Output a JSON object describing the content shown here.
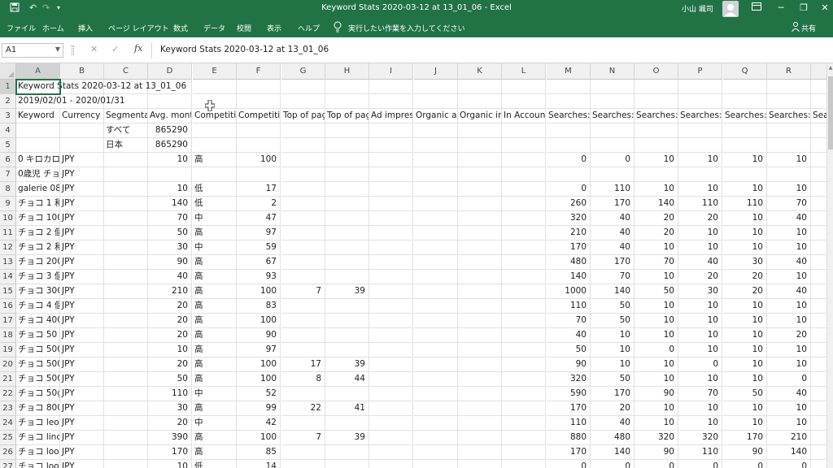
{
  "titlebar": {
    "title": "Keyword Stats 2020-03-12 at 13_01_06  -  Excel",
    "user": "小山 颯司",
    "icons": [
      "save-icon",
      "undo-icon",
      "redo-icon",
      "customize-qat-icon",
      "ribbon-display-icon",
      "minimize-icon",
      "restore-icon",
      "close-icon"
    ]
  },
  "ribbon": {
    "tabs": [
      "ファイル",
      "ホーム",
      "挿入",
      "ページ レイアウト",
      "数式",
      "データ",
      "校閲",
      "表示",
      "ヘルプ"
    ],
    "tell_me": "実行したい作業を入力してください",
    "share": "共有"
  },
  "formula_bar": {
    "name_box": "A1",
    "fx": "fx",
    "content": "Keyword Stats 2020-03-12 at 13_01_06"
  },
  "sheet": {
    "columns": [
      "A",
      "B",
      "C",
      "D",
      "E",
      "F",
      "G",
      "H",
      "I",
      "J",
      "K",
      "L",
      "M",
      "N",
      "O",
      "P",
      "Q",
      "R"
    ],
    "selected_cell": "A1",
    "rows": [
      {
        "n": "1",
        "cells": {
          "A": "Keyword Stats 2020-03-12 at 13_01_06"
        }
      },
      {
        "n": "2",
        "cells": {
          "A": "2019/02/01 - 2020/01/31"
        }
      },
      {
        "n": "3",
        "cells": {
          "A": "Keyword",
          "B": "Currency",
          "C": "Segmentat",
          "D": "Avg. mont",
          "E": "Competitic",
          "F": "Competitic",
          "G": "Top of pag",
          "H": "Top of pag",
          "I": "Ad impres",
          "J": "Organic av",
          "K": "Organic im",
          "L": "In Account",
          "M": "Searches:",
          "N": "Searches:",
          "O": "Searches:",
          "P": "Searches:",
          "Q": "Searches:",
          "R": "Searches:",
          "S": "Sea"
        }
      },
      {
        "n": "4",
        "cells": {
          "C": "すべて",
          "D": "865290"
        }
      },
      {
        "n": "5",
        "cells": {
          "C": "日本",
          "D": "865290"
        }
      },
      {
        "n": "6",
        "cells": {
          "A": "0 キロカロ",
          "B": "JPY",
          "D": "10",
          "E": "高",
          "F": "100",
          "M": "0",
          "N": "0",
          "O": "10",
          "P": "10",
          "Q": "10",
          "R": "10"
        }
      },
      {
        "n": "7",
        "cells": {
          "A": "0歳児 チョ",
          "B": "JPY"
        }
      },
      {
        "n": "8",
        "cells": {
          "A": "galerie 08",
          "B": "JPY",
          "D": "10",
          "E": "低",
          "F": "17",
          "M": "0",
          "N": "110",
          "O": "10",
          "P": "10",
          "Q": "10",
          "R": "10"
        }
      },
      {
        "n": "9",
        "cells": {
          "A": "チョコ 1 和",
          "B": "JPY",
          "D": "140",
          "E": "低",
          "F": "2",
          "M": "260",
          "N": "170",
          "O": "140",
          "P": "110",
          "Q": "110",
          "R": "70"
        }
      },
      {
        "n": "10",
        "cells": {
          "A": "チョコ 100",
          "B": "JPY",
          "D": "70",
          "E": "中",
          "F": "47",
          "M": "320",
          "N": "40",
          "O": "20",
          "P": "20",
          "Q": "10",
          "R": "40"
        }
      },
      {
        "n": "11",
        "cells": {
          "A": "チョコ 2 個",
          "B": "JPY",
          "D": "50",
          "E": "高",
          "F": "97",
          "M": "210",
          "N": "40",
          "O": "20",
          "P": "10",
          "Q": "10",
          "R": "10"
        }
      },
      {
        "n": "12",
        "cells": {
          "A": "チョコ 2 和",
          "B": "JPY",
          "D": "30",
          "E": "中",
          "F": "59",
          "M": "170",
          "N": "40",
          "O": "10",
          "P": "10",
          "Q": "10",
          "R": "10"
        }
      },
      {
        "n": "13",
        "cells": {
          "A": "チョコ 200",
          "B": "JPY",
          "D": "90",
          "E": "高",
          "F": "67",
          "M": "480",
          "N": "170",
          "O": "70",
          "P": "40",
          "Q": "30",
          "R": "40"
        }
      },
      {
        "n": "14",
        "cells": {
          "A": "チョコ 3 個",
          "B": "JPY",
          "D": "40",
          "E": "高",
          "F": "93",
          "M": "140",
          "N": "70",
          "O": "10",
          "P": "20",
          "Q": "20",
          "R": "10"
        }
      },
      {
        "n": "15",
        "cells": {
          "A": "チョコ 300",
          "B": "JPY",
          "D": "210",
          "E": "高",
          "F": "100",
          "G": "7",
          "H": "39",
          "M": "1000",
          "N": "140",
          "O": "50",
          "P": "30",
          "Q": "20",
          "R": "40"
        }
      },
      {
        "n": "16",
        "cells": {
          "A": "チョコ 4 個",
          "B": "JPY",
          "D": "20",
          "E": "高",
          "F": "83",
          "M": "110",
          "N": "50",
          "O": "10",
          "P": "10",
          "Q": "10",
          "R": "10"
        }
      },
      {
        "n": "17",
        "cells": {
          "A": "チョコ 400",
          "B": "JPY",
          "D": "20",
          "E": "高",
          "F": "100",
          "M": "70",
          "N": "50",
          "O": "10",
          "P": "10",
          "Q": "10",
          "R": "10"
        }
      },
      {
        "n": "18",
        "cells": {
          "A": "チョコ 50",
          "B": "JPY",
          "D": "20",
          "E": "高",
          "F": "90",
          "M": "40",
          "N": "10",
          "O": "10",
          "P": "10",
          "Q": "10",
          "R": "20"
        }
      },
      {
        "n": "19",
        "cells": {
          "A": "チョコ 500",
          "B": "JPY",
          "D": "10",
          "E": "高",
          "F": "97",
          "M": "50",
          "N": "10",
          "O": "0",
          "P": "10",
          "Q": "10",
          "R": "10"
        }
      },
      {
        "n": "20",
        "cells": {
          "A": "チョコ 500",
          "B": "JPY",
          "D": "20",
          "E": "高",
          "F": "100",
          "G": "17",
          "H": "39",
          "M": "90",
          "N": "10",
          "O": "10",
          "P": "0",
          "Q": "10",
          "R": "10"
        }
      },
      {
        "n": "21",
        "cells": {
          "A": "チョコ 500",
          "B": "JPY",
          "D": "50",
          "E": "高",
          "F": "100",
          "G": "8",
          "H": "44",
          "M": "320",
          "N": "50",
          "O": "10",
          "P": "10",
          "Q": "10",
          "R": "0"
        }
      },
      {
        "n": "22",
        "cells": {
          "A": "チョコ 50g",
          "B": "JPY",
          "D": "110",
          "E": "中",
          "F": "52",
          "M": "590",
          "N": "170",
          "O": "90",
          "P": "70",
          "Q": "50",
          "R": "40"
        }
      },
      {
        "n": "23",
        "cells": {
          "A": "チョコ 800",
          "B": "JPY",
          "D": "30",
          "E": "高",
          "F": "99",
          "G": "22",
          "H": "41",
          "M": "170",
          "N": "20",
          "O": "10",
          "P": "10",
          "Q": "10",
          "R": "10"
        }
      },
      {
        "n": "24",
        "cells": {
          "A": "チョコ leo",
          "B": "JPY",
          "D": "20",
          "E": "中",
          "F": "42",
          "M": "110",
          "N": "40",
          "O": "10",
          "P": "10",
          "Q": "10",
          "R": "10"
        }
      },
      {
        "n": "25",
        "cells": {
          "A": "チョコ linc",
          "B": "JPY",
          "D": "390",
          "E": "高",
          "F": "100",
          "G": "7",
          "H": "39",
          "M": "880",
          "N": "480",
          "O": "320",
          "P": "320",
          "Q": "170",
          "R": "210"
        }
      },
      {
        "n": "26",
        "cells": {
          "A": "チョコ lool",
          "B": "JPY",
          "D": "170",
          "E": "高",
          "F": "85",
          "M": "170",
          "N": "140",
          "O": "90",
          "P": "110",
          "Q": "90",
          "R": "140"
        }
      },
      {
        "n": "27",
        "cells": {
          "A": "チョコ lool",
          "B": "JPY",
          "D": "10",
          "E": "低",
          "F": "14",
          "M": "0",
          "N": "0",
          "O": "0",
          "P": "0",
          "Q": "0",
          "R": "0"
        }
      }
    ]
  }
}
